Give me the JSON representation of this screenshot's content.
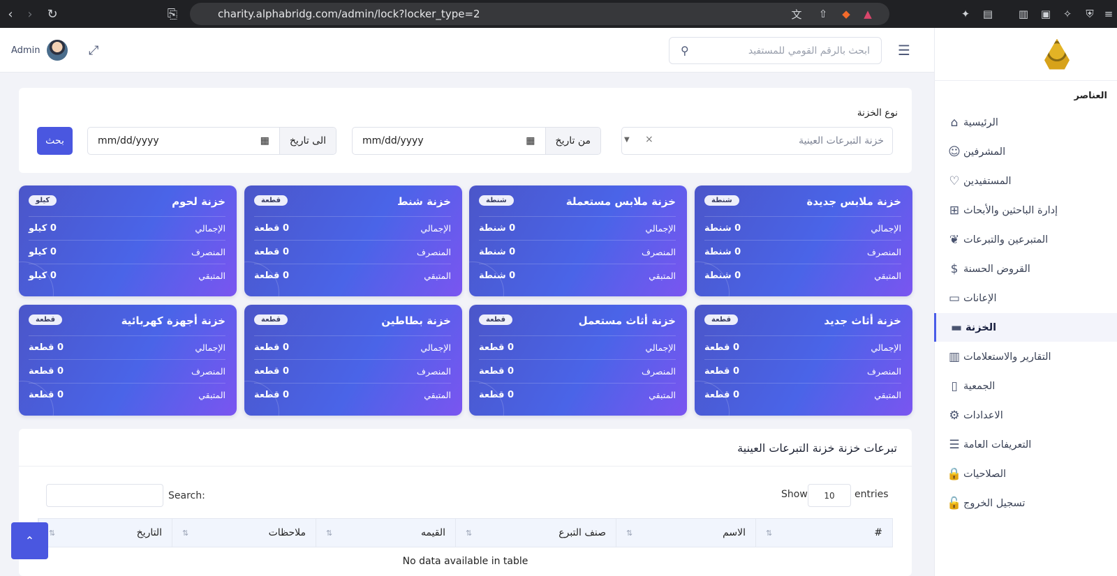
{
  "browser": {
    "url": "charity.alphabridg.com/admin/lock?locker_type=2"
  },
  "header": {
    "search_placeholder": "ابحث بالرقم القومي للمستفيد",
    "user_name": "Admin"
  },
  "sidebar": {
    "title": "العناصر",
    "items": [
      {
        "label": "الرئيسية",
        "icon": "home-icon"
      },
      {
        "label": "المشرفين",
        "icon": "users-icon"
      },
      {
        "label": "المستفيدين",
        "icon": "hand-heart-icon"
      },
      {
        "label": "إدارة الباحثين والأبحاث",
        "icon": "sitemap-icon"
      },
      {
        "label": "المتبرعين والتبرعات",
        "icon": "donation-icon"
      },
      {
        "label": "القروض الحسنة",
        "icon": "loan-icon"
      },
      {
        "label": "الإعانات",
        "icon": "card-icon"
      },
      {
        "label": "الخزنة",
        "icon": "wallet-icon",
        "active": true
      },
      {
        "label": "التقارير والاستعلامات",
        "icon": "chart-icon"
      },
      {
        "label": "الجمعية",
        "icon": "building-icon"
      },
      {
        "label": "الاعدادات",
        "icon": "gear-icon"
      },
      {
        "label": "التعريفات العامة",
        "icon": "database-icon"
      },
      {
        "label": "الصلاحيات",
        "icon": "lock-icon"
      },
      {
        "label": "تسجيل الخروج",
        "icon": "unlock-icon"
      }
    ]
  },
  "filter": {
    "type_label": "نوع الخزنة",
    "type_value": "خزنة التبرعات العينية",
    "clear": "×",
    "from_label": "من تاريخ",
    "to_label": "الى تاريخ",
    "date_placeholder": "mm/dd/yyyy",
    "search_button": "بحث"
  },
  "cards_labels": {
    "total": "الإجمالي",
    "spent": "المنصرف",
    "remaining": "المتبقي"
  },
  "cards": [
    {
      "title": "خزنة ملابس جديدة",
      "unit": "شنطة",
      "total": "0 شنطة",
      "spent": "0 شنطة",
      "remaining": "0 شنطة"
    },
    {
      "title": "خزنة ملابس مستعملة",
      "unit": "شنطة",
      "total": "0 شنطة",
      "spent": "0 شنطة",
      "remaining": "0 شنطة"
    },
    {
      "title": "خزنة شنط",
      "unit": "قطعة",
      "total": "0 قطعة",
      "spent": "0 قطعة",
      "remaining": "0 قطعة"
    },
    {
      "title": "خزنة لحوم",
      "unit": "كيلو",
      "total": "0 كيلو",
      "spent": "0 كيلو",
      "remaining": "0 كيلو"
    },
    {
      "title": "خزنة أثاث جديد",
      "unit": "قطعة",
      "total": "0 قطعة",
      "spent": "0 قطعة",
      "remaining": "0 قطعة"
    },
    {
      "title": "خزنة أثاث مستعمل",
      "unit": "قطعة",
      "total": "0 قطعة",
      "spent": "0 قطعة",
      "remaining": "0 قطعة"
    },
    {
      "title": "خزنة بطاطين",
      "unit": "قطعة",
      "total": "0 قطعة",
      "spent": "0 قطعة",
      "remaining": "0 قطعة"
    },
    {
      "title": "خزنة أجهزة كهربائية",
      "unit": "قطعة",
      "total": "0 قطعة",
      "spent": "0 قطعة",
      "remaining": "0 قطعة"
    }
  ],
  "table": {
    "title": "تبرعات خزنة خزنة التبرعات العينية",
    "show_label": "Show",
    "entries_value": "10",
    "entries_label": "entries",
    "search_label": "Search:",
    "columns": [
      "#",
      "الاسم",
      "صنف التبرع",
      "القيمه",
      "ملاحظات",
      "التاريخ"
    ],
    "empty_text": "No data available in table"
  },
  "colors": {
    "accent": "#4a57e0",
    "card_start": "#4b56c9",
    "card_end": "#7a55f0"
  }
}
